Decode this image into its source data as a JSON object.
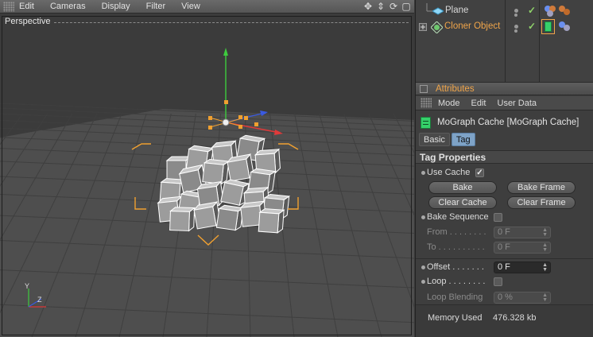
{
  "viewport": {
    "menu": [
      "Edit",
      "Cameras",
      "Display",
      "Filter",
      "View"
    ],
    "nav_icons": [
      "move-view-icon",
      "zoom-view-icon",
      "rotate-view-icon",
      "maximize-view-icon"
    ],
    "label": "Perspective",
    "axis_labels": {
      "y": "Y",
      "z": "Z"
    }
  },
  "object_manager": {
    "objects": [
      {
        "name": "Plane",
        "color": "#d8d8d8"
      },
      {
        "name": "Cloner Object",
        "color": "#f0a54a"
      }
    ]
  },
  "attributes": {
    "title": "Attributes",
    "menu": [
      "Mode",
      "Edit",
      "User Data"
    ],
    "tag_title": "MoGraph Cache [MoGraph Cache]",
    "tabs": [
      "Basic",
      "Tag"
    ],
    "active_tab": "Tag",
    "section": "Tag Properties",
    "use_cache_label": "Use Cache",
    "use_cache_checked": true,
    "buttons": {
      "bake": "Bake",
      "bake_frame": "Bake Frame",
      "clear_cache": "Clear Cache",
      "clear_frame": "Clear Frame"
    },
    "bake_sequence_label": "Bake Sequence",
    "from_label": "From . . . . . . . .",
    "from_value": "0 F",
    "to_label": "To . . . . . . . . . .",
    "to_value": "0 F",
    "offset_label": "Offset . . . . . . .",
    "offset_value": "0 F",
    "loop_label": "Loop . . . . . . . .",
    "loop_blending_label": "Loop Blending",
    "loop_blending_value": "0 %",
    "memory_label": "Memory Used",
    "memory_value": "476.328 kb"
  },
  "colors": {
    "accent_orange": "#f0a54a",
    "tab_active": "#7ea3c7",
    "axis_y": "#3ecb3e",
    "axis_x": "#e03a3a",
    "axis_z": "#3a5ae0"
  }
}
